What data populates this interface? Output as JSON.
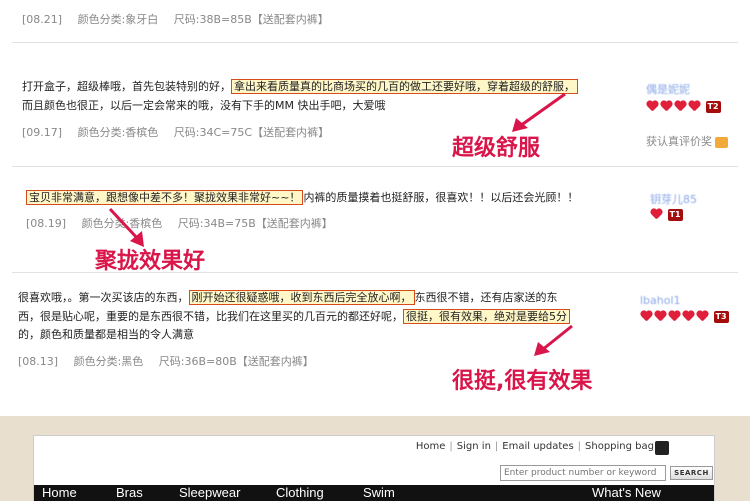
{
  "review0": {
    "date": "[08.21]",
    "color": "颜色分类:象牙白",
    "size": "尺码:38B=85B【送配套内裤】"
  },
  "review1": {
    "pre": "打开盒子，超级棒哦，首先包装特别的好，",
    "highlight": "拿出来看质量真的比商场买的几百的做工还要好哦，穿着超级的舒服，",
    "line2": "而且颜色也很正，以后一定会常来的哦，没有下手的MM 快出手吧，大爱哦",
    "date": "[09.17]",
    "color": "颜色分类:香槟色",
    "size": "尺码:34C=75C【送配套内裤】",
    "note": "超级舒服",
    "user": "偶是妮妮",
    "badge": "T2",
    "verify": "获认真评价奖"
  },
  "review2": {
    "highlight": "宝贝非常满意，跟想像中差不多！聚拢效果非常好~~！",
    "post": "内裤的质量摸着也挺舒服，很喜欢！！以后还会光顾！！",
    "date": "[08.19]",
    "color": "颜色分类:香槟色",
    "size": "尺码:34B=75B【送配套内裤】",
    "note": "聚拢效果好",
    "user": "钥芽儿85",
    "badge": "T1"
  },
  "review3": {
    "pre": "很喜欢哦，。第一次买该店的东西，",
    "highlight1": "刚开始还很疑惑哦，收到东西后完全放心啊，",
    "mid": "东西很不错，还有店家送的东",
    "line2pre": "西，很是贴心呢，重要的是东西很不错，比我们在这里买的几百元的都还好呢，",
    "highlight2": "很挺，很有效果，绝对是要给5分",
    "line3": "的，颜色和质量都是相当的令人满意",
    "date": "[08.13]",
    "color": "颜色分类:黑色",
    "size": "尺码:36B=80B【送配套内裤】",
    "note": "很挺,很有效果",
    "user": "lbahol1",
    "badge": "T3"
  },
  "site": {
    "links": [
      "Home",
      "Sign in",
      "Email updates",
      "Shopping bag"
    ],
    "search_placeholder": "Enter product number or keyword",
    "search_button": "SEARCH",
    "nav": [
      "Home",
      "Bras",
      "Sleepwear",
      "Clothing",
      "Swim",
      "What's New"
    ]
  },
  "colors": {
    "highlight_border": "#d64b1a",
    "note": "#d9154a",
    "nav_bg": "#111111",
    "footer_bg": "#e9dfce"
  }
}
